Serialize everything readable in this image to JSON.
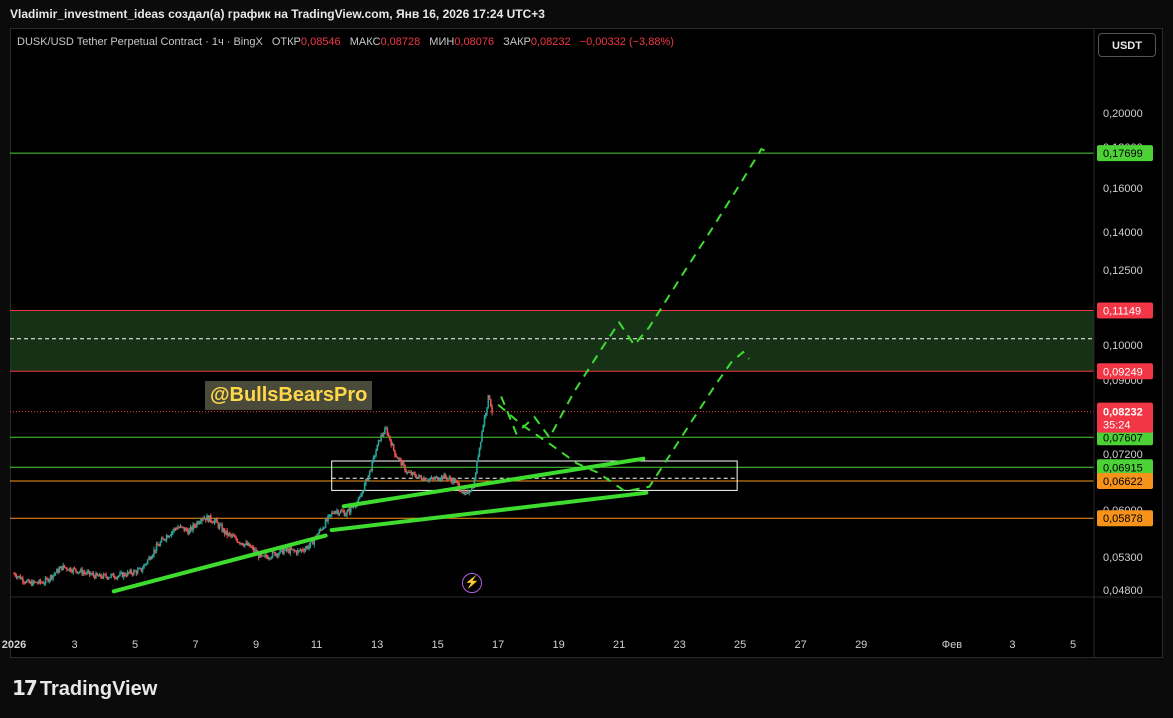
{
  "header": {
    "title": "Vladimir_investment_ideas создал(а) график на TradingView.com, Янв 16, 2026 17:24 UTC+3"
  },
  "legend": {
    "symbol": "DUSK/USD Tether Perpetual Contract · 1ч · BingX",
    "open_label": "ОТКР",
    "open": "0,08546",
    "high_label": "МАКС",
    "high": "0,08728",
    "low_label": "МИН",
    "low": "0,08076",
    "close_label": "ЗАКР",
    "close": "0,08232",
    "change": "−0,00332 (−3,88%)"
  },
  "currency_button": "USDT",
  "watermark_text": "@BullsBearsPro",
  "bolt_icon": "⚡",
  "footer": {
    "logo_mark": "17",
    "logo_text": "TradingView"
  },
  "colors": {
    "background": "#000000",
    "up": "#26a69a",
    "down": "#ef5350",
    "green_line": "#4cd137",
    "red_line": "#f23645",
    "orange_line": "#f7931a",
    "zone_fill": "#1a3a1a",
    "projection": "#3ddc2f"
  },
  "chart_data": {
    "type": "line",
    "title": "",
    "ylim": [
      0.0475,
      0.206
    ],
    "y_ticks": [
      "0,20000",
      "0,18000",
      "0,16000",
      "0,14000",
      "0,12500",
      "0,10000",
      "0,09000",
      "0,07200",
      "0,06000",
      "0,05300",
      "0,04800"
    ],
    "x_ticks": [
      {
        "label": "2026",
        "d": 1
      },
      {
        "label": "3",
        "d": 3
      },
      {
        "label": "5",
        "d": 5
      },
      {
        "label": "7",
        "d": 7
      },
      {
        "label": "9",
        "d": 9
      },
      {
        "label": "11",
        "d": 11
      },
      {
        "label": "13",
        "d": 13
      },
      {
        "label": "15",
        "d": 15
      },
      {
        "label": "17",
        "d": 17
      },
      {
        "label": "19",
        "d": 19
      },
      {
        "label": "21",
        "d": 21
      },
      {
        "label": "23",
        "d": 23
      },
      {
        "label": "25",
        "d": 25
      },
      {
        "label": "27",
        "d": 27
      },
      {
        "label": "29",
        "d": 29
      },
      {
        "label": "Фев",
        "d": 32
      },
      {
        "label": "3",
        "d": 34
      },
      {
        "label": "5",
        "d": 36
      }
    ],
    "price_path": [
      [
        1,
        0.0505
      ],
      [
        1.5,
        0.049
      ],
      [
        2,
        0.0492
      ],
      [
        2.6,
        0.0515
      ],
      [
        3.2,
        0.0508
      ],
      [
        3.8,
        0.05
      ],
      [
        4.5,
        0.0502
      ],
      [
        5.2,
        0.051
      ],
      [
        5.6,
        0.0538
      ],
      [
        6.0,
        0.056
      ],
      [
        6.4,
        0.0575
      ],
      [
        6.8,
        0.0568
      ],
      [
        7.2,
        0.059
      ],
      [
        7.6,
        0.0585
      ],
      [
        8.0,
        0.0565
      ],
      [
        8.4,
        0.0555
      ],
      [
        8.8,
        0.0545
      ],
      [
        9.2,
        0.0528
      ],
      [
        9.6,
        0.0535
      ],
      [
        10.0,
        0.054
      ],
      [
        10.4,
        0.0538
      ],
      [
        10.8,
        0.0548
      ],
      [
        11.2,
        0.0575
      ],
      [
        11.6,
        0.06
      ],
      [
        12.0,
        0.0595
      ],
      [
        12.4,
        0.062
      ],
      [
        12.8,
        0.069
      ],
      [
        13.1,
        0.076
      ],
      [
        13.3,
        0.078
      ],
      [
        13.6,
        0.072
      ],
      [
        14.0,
        0.068
      ],
      [
        14.4,
        0.067
      ],
      [
        14.8,
        0.0665
      ],
      [
        15.2,
        0.0672
      ],
      [
        15.6,
        0.066
      ],
      [
        15.9,
        0.063
      ],
      [
        16.2,
        0.0655
      ],
      [
        16.5,
        0.079
      ],
      [
        16.7,
        0.0865
      ],
      [
        16.8,
        0.0823
      ]
    ],
    "candle_count": 380,
    "horizontal_levels": [
      {
        "value": 0.17699,
        "label": "0,17699",
        "color": "#4cd137",
        "text_color": "#000000"
      },
      {
        "value": 0.11149,
        "label": "0,11149",
        "color": "#f23645",
        "text_color": "#ffffff"
      },
      {
        "value": 0.09249,
        "label": "0,09249",
        "color": "#f23645",
        "text_color": "#ffffff"
      },
      {
        "value": 0.07607,
        "label": "0,07607",
        "color": "#4cd137",
        "text_color": "#000000"
      },
      {
        "value": 0.06915,
        "label": "0,06915",
        "color": "#4cd137",
        "text_color": "#000000"
      },
      {
        "value": 0.06622,
        "label": "0,06622",
        "color": "#f7931a",
        "text_color": "#000000"
      },
      {
        "value": 0.05878,
        "label": "0,05878",
        "color": "#f7931a",
        "text_color": "#000000"
      }
    ],
    "current_price": {
      "value": 0.08232,
      "label": "0,08232",
      "countdown": "35:24"
    },
    "zone": {
      "top": 0.11149,
      "bottom": 0.09249,
      "mid": 0.1021
    },
    "consolidation_box": {
      "d0": 11.5,
      "d1": 24.9,
      "top": 0.0705,
      "bottom": 0.0642,
      "mid": 0.0668
    },
    "trendlines": [
      {
        "from": [
          4.3,
          0.0478
        ],
        "to": [
          11.3,
          0.0562
        ]
      },
      {
        "from": [
          11.5,
          0.057
        ],
        "to": [
          21.9,
          0.0637
        ]
      },
      {
        "from": [
          11.9,
          0.0608
        ],
        "to": [
          21.8,
          0.071
        ]
      }
    ],
    "projections": [
      [
        [
          17.1,
          0.086
        ],
        [
          17.6,
          0.077
        ],
        [
          18.2,
          0.081
        ],
        [
          18.7,
          0.076
        ],
        [
          19.5,
          0.087
        ],
        [
          20.5,
          0.1
        ],
        [
          21.0,
          0.1075
        ],
        [
          21.5,
          0.1
        ],
        [
          22.0,
          0.106
        ],
        [
          23.0,
          0.122
        ],
        [
          24.0,
          0.14
        ],
        [
          25.0,
          0.162
        ],
        [
          25.7,
          0.179
        ],
        [
          26.0,
          0.177
        ]
      ],
      [
        [
          17.0,
          0.084
        ],
        [
          17.8,
          0.079
        ],
        [
          18.8,
          0.074
        ],
        [
          19.6,
          0.07
        ],
        [
          20.3,
          0.068
        ],
        [
          21.2,
          0.064
        ],
        [
          22.0,
          0.065
        ],
        [
          22.6,
          0.071
        ],
        [
          23.4,
          0.08
        ],
        [
          24.2,
          0.089
        ],
        [
          24.7,
          0.095
        ],
        [
          25.1,
          0.098
        ],
        [
          25.3,
          0.096
        ]
      ]
    ]
  }
}
